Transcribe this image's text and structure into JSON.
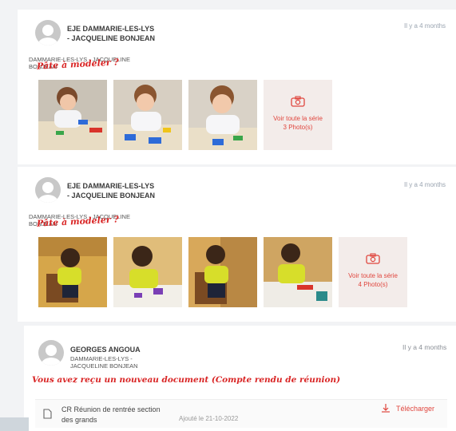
{
  "posts": [
    {
      "author": "EJE DAMMARIE-LES-LYS - JACQUELINE BONJEAN",
      "sub_lines": [
        "DAMMARIE-LES-LYS - JACQUELINE",
        "BONJEAN"
      ],
      "time": "Il y a 4 months",
      "annotation": "Pâte à modeler ?",
      "see_all_label": "Voir toute la série",
      "photo_count": "3 Photo(s)"
    },
    {
      "author": "EJE DAMMARIE-LES-LYS - JACQUELINE BONJEAN",
      "sub_lines": [
        "DAMMARIE-LES-LYS - JACQUELINE",
        "BONJEAN"
      ],
      "time": "Il y a 4 months",
      "annotation": "Pâte à modeler ?",
      "see_all_label": "Voir toute la série",
      "photo_count": "4 Photo(s)"
    },
    {
      "author": "GEORGES ANGOUA",
      "sub_lines": [
        "DAMMARIE-LES-LYS -",
        "JACQUELINE BONJEAN"
      ],
      "time": "Il y a 4 months",
      "annotation": "Vous avez reçu un nouveau document (Compte rendu de réunion)",
      "document": {
        "title": "CR Réunion de rentrée section des grands",
        "added": "Ajouté le 21-10-2022",
        "download_label": "Télécharger"
      }
    }
  ],
  "colors": {
    "accent": "#e0463e",
    "annotation": "#d92525",
    "muted": "#9aa4b0"
  }
}
